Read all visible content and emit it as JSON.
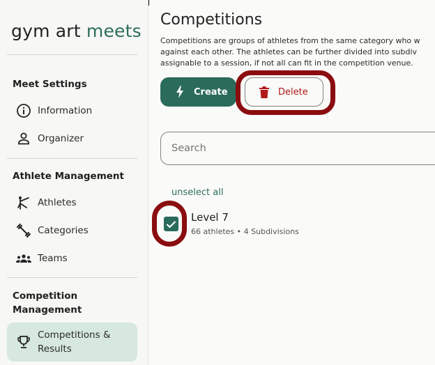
{
  "brand": {
    "part1": "gym art",
    "part2": "meets"
  },
  "sidebar": {
    "sections": [
      {
        "title": "Meet Settings"
      },
      {
        "title": "Athlete Management"
      },
      {
        "title": "Competition Management"
      }
    ],
    "items": [
      {
        "label": "Information",
        "icon": "info-icon"
      },
      {
        "label": "Organizer",
        "icon": "person-icon"
      },
      {
        "label": "Athletes",
        "icon": "gymnast-icon"
      },
      {
        "label": "Categories",
        "icon": "dumbbell-icon"
      },
      {
        "label": "Teams",
        "icon": "groups-icon"
      },
      {
        "label": "Competitions & Results",
        "icon": "trophy-icon",
        "active": true
      }
    ]
  },
  "main": {
    "title": "Competitions",
    "description": [
      "Competitions are groups of athletes from the same category who w",
      "against each other. The athletes can be further divided into subdiv",
      "assignable to a session, if not all can fit in the competition venue."
    ],
    "create_label": "Create",
    "delete_label": "Delete",
    "search_placeholder": "Search",
    "unselect_label": "unselect all",
    "competitions": [
      {
        "name": "Level 7",
        "details": "66 athletes • 4 Subdivisions",
        "checked": true
      }
    ]
  },
  "colors": {
    "accent": "#2b6b5b",
    "danger": "#b01a1a",
    "highlight": "#8a0d10",
    "active_bg": "#d6e8df"
  }
}
